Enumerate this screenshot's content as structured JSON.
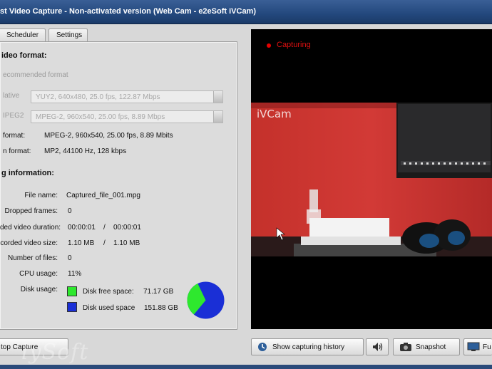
{
  "window": {
    "title": "st Video Capture - Non-activated version (Web Cam - e2eSoft iVCam)"
  },
  "tabs": [
    {
      "label": "Scheduler"
    },
    {
      "label": "Settings"
    }
  ],
  "video_format": {
    "heading": "ideo format:",
    "recommended_label": "ecommended format",
    "native_label": "lative",
    "native_value": "YUY2, 640x480, 25.0 fps, 122.87 Mbps",
    "mpeg2_label": "IPEG2",
    "mpeg2_value": "MPEG-2, 960x540, 25.00 fps, 8.89 Mbps",
    "video_format_label": "format:",
    "video_format_value": "MPEG-2, 960x540, 25.00 fps, 8.89 Mbits",
    "audio_format_label": "n format:",
    "audio_format_value": "MP2, 44100 Hz, 128 kbps"
  },
  "capturing_info": {
    "heading": "g information:",
    "file_name_label": "File name:",
    "file_name_value": "Captured_file_001.mpg",
    "dropped_label": "Dropped frames:",
    "dropped_value": "0",
    "duration_label": "ded video duration:",
    "duration_value": "00:00:01",
    "duration_total": "00:00:01",
    "size_label": "corded video size:",
    "size_value": "1.10 MB",
    "size_total": "1.10 MB",
    "separator": "/",
    "files_label": "Number of files:",
    "files_value": "0",
    "cpu_label": "CPU usage:",
    "cpu_value": "11%",
    "disk_label": "Disk usage:",
    "disk_free_label": "Disk free space:",
    "disk_free_value": "71.17 GB",
    "disk_used_label": "Disk used space",
    "disk_used_value": "151.88 GB"
  },
  "disk_chart": {
    "free_gb": 71.17,
    "used_gb": 151.88,
    "free_color": "#2ee82e",
    "used_color": "#1a2fd6"
  },
  "preview": {
    "status": "Capturing",
    "overlay_text": "iVCam"
  },
  "buttons": {
    "stop_capture": "top Capture",
    "history": "Show capturing history",
    "snapshot": "Snapshot",
    "full": "Fu"
  },
  "watermark": "lySoft",
  "icons": {
    "history": "history-icon",
    "speaker": "speaker-icon",
    "snapshot": "camera-icon",
    "full": "fullscreen-icon"
  }
}
